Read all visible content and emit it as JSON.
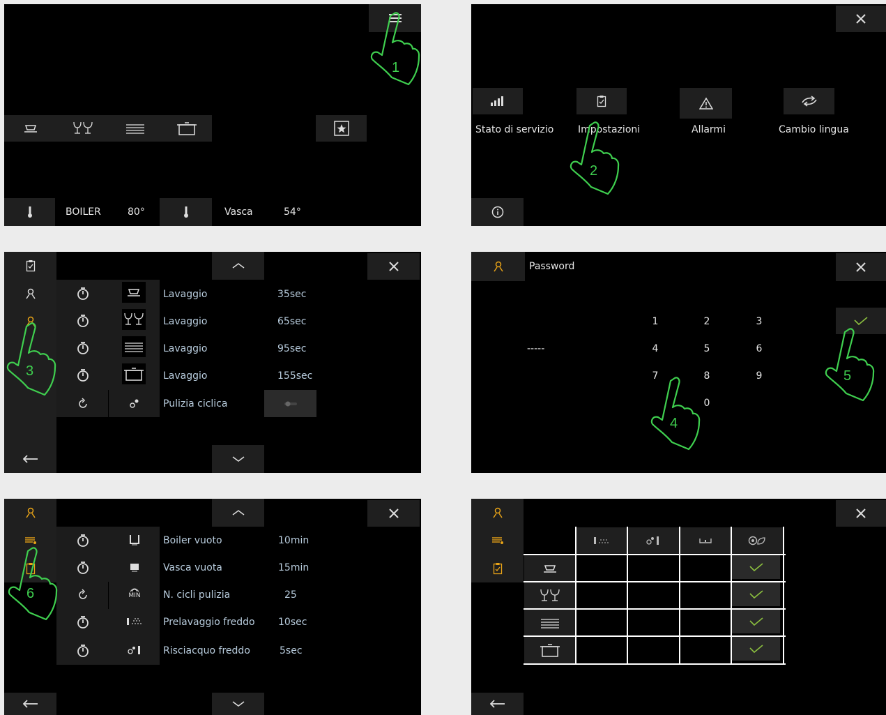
{
  "panel1": {
    "status": {
      "boiler_label": "BOILER",
      "boiler_temp": "80°",
      "tank_label": "Vasca",
      "tank_temp": "54°"
    },
    "step": "1"
  },
  "panel2": {
    "menu": [
      {
        "label": "Stato di servizio",
        "icon": "bar-chart-icon"
      },
      {
        "label": "Impostazioni",
        "icon": "clipboard-icon"
      },
      {
        "label": "Allarmi",
        "icon": "warning-icon"
      },
      {
        "label": "Cambio lingua",
        "icon": "language-swap-icon"
      }
    ],
    "step": "2"
  },
  "panel3": {
    "rows": [
      {
        "label": "Lavaggio",
        "value": "35sec"
      },
      {
        "label": "Lavaggio",
        "value": "65sec"
      },
      {
        "label": "Lavaggio",
        "value": "95sec"
      },
      {
        "label": "Lavaggio",
        "value": "155sec"
      },
      {
        "label": "Pulizia ciclica",
        "value": ""
      }
    ],
    "step": "3"
  },
  "panel4": {
    "title": "Password",
    "entry": "-----",
    "keys": [
      "1",
      "2",
      "3",
      "4",
      "5",
      "6",
      "7",
      "8",
      "9",
      "0"
    ],
    "step_keypad": "4",
    "step_confirm": "5"
  },
  "panel5": {
    "rows": [
      {
        "label": "Boiler vuoto",
        "value": "10min"
      },
      {
        "label": "Vasca vuota",
        "value": "15min"
      },
      {
        "label": "N. cicli pulizia",
        "value": "25"
      },
      {
        "label": "Prelavaggio freddo",
        "value": "10sec"
      },
      {
        "label": "Risciacquo freddo",
        "value": "5sec"
      }
    ],
    "min_icon_label": "MIN",
    "step": "6"
  },
  "colors": {
    "accent_orange": "#e8a317",
    "hand_green": "#3fcf4f",
    "check_green": "#8bbf3f",
    "label_blue": "#b8ccdd"
  }
}
